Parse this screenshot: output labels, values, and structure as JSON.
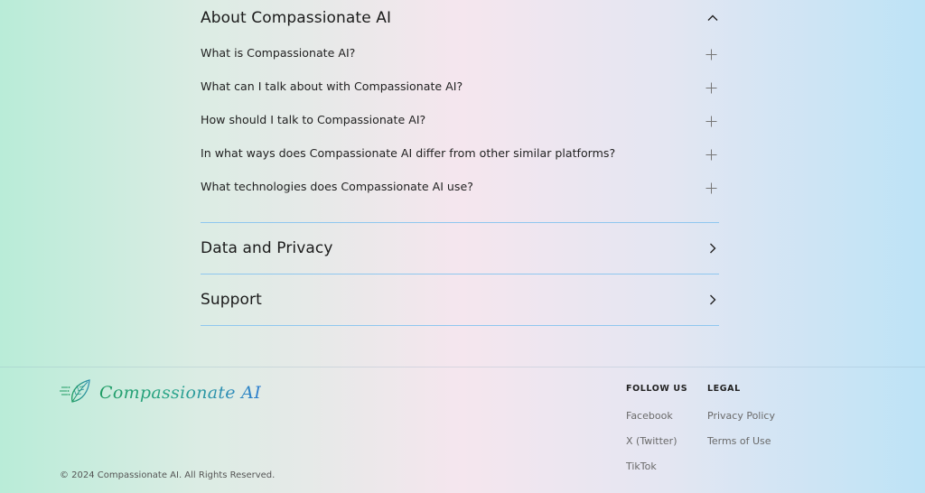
{
  "faq": {
    "about": {
      "title": "About Compassionate AI",
      "questions": [
        {
          "label": "What is Compassionate AI?"
        },
        {
          "label": "What can I talk about with Compassionate AI?"
        },
        {
          "label": "How should I talk to Compassionate AI?"
        },
        {
          "label": "In what ways does Compassionate AI differ from other similar platforms?"
        },
        {
          "label": "What technologies does Compassionate AI use?"
        }
      ]
    },
    "data_privacy": {
      "title": "Data and Privacy"
    },
    "support": {
      "title": "Support"
    }
  },
  "footer": {
    "logo_text": "Compassionate AI",
    "copyright": "© 2024 Compassionate AI. All Rights Reserved.",
    "follow_us": {
      "title": "FOLLOW US",
      "links": [
        {
          "label": "Facebook"
        },
        {
          "label": "X (Twitter)"
        },
        {
          "label": "TikTok"
        }
      ]
    },
    "legal": {
      "title": "LEGAL",
      "links": [
        {
          "label": "Privacy Policy"
        },
        {
          "label": "Terms of Use"
        }
      ]
    }
  },
  "colors": {
    "divider": "#8fc7ef",
    "logo_green": "#1f9c63",
    "logo_blue": "#2f7fd0"
  },
  "icons": {
    "expanded": "chevron-up-icon",
    "collapsed": "chevron-right-icon",
    "question": "plus-icon",
    "logo": "leaf-logo-icon"
  }
}
